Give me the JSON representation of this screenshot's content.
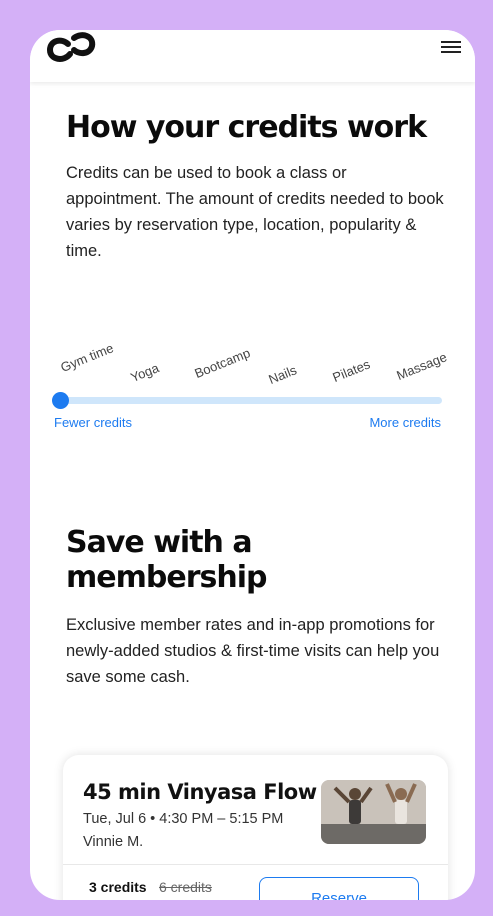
{
  "header": {
    "logo_icon": "classpass-logo-icon",
    "menu_icon": "hamburger-menu-icon"
  },
  "credits_section": {
    "title": "How your credits work",
    "description": "Credits can be used to book a class or appointment. The amount of credits needed to book varies by reservation type, location, popularity & time.",
    "scale": {
      "categories": [
        "Gym time",
        "Yoga",
        "Bootcamp",
        "Nails",
        "Pilates",
        "Massage"
      ],
      "left_label": "Fewer credits",
      "right_label": "More credits",
      "level": 0
    }
  },
  "membership_section": {
    "title": "Save with a membership",
    "description": "Exclusive member rates and in-app promotions for newly-added studios & first-time visits can help you save some cash."
  },
  "class_card": {
    "title": "45 min Vinyasa Flow",
    "datetime": "Tue, Jul 6 • 4:30 PM – 5:15 PM",
    "instructor": "Vinnie M.",
    "credits": "3 credits",
    "original_credits": "6 credits",
    "button_label": "Reserve"
  },
  "colors": {
    "frame": "#d4b0f7",
    "accent": "#1d7bf0",
    "track": "#cfe6fb"
  }
}
